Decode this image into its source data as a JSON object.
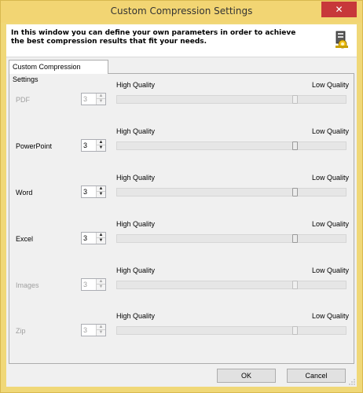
{
  "window": {
    "title": "Custom Compression Settings",
    "close_glyph": "✕"
  },
  "header": {
    "text": "In this window you can define your own parameters in order to achieve\nthe best compression results that fit your needs.",
    "icon": "settings-wizard-icon"
  },
  "tab": {
    "label": "Custom Compression Settings"
  },
  "rows": [
    {
      "label": "PDF",
      "enabled": false,
      "value": "3",
      "high": "High Quality",
      "low": "Low Quality",
      "level": 0.78
    },
    {
      "label": "PowerPoint",
      "enabled": true,
      "value": "3",
      "high": "High Quality",
      "low": "Low Quality",
      "level": 0.78
    },
    {
      "label": "Word",
      "enabled": true,
      "value": "3",
      "high": "High Quality",
      "low": "Low Quality",
      "level": 0.78
    },
    {
      "label": "Excel",
      "enabled": true,
      "value": "3",
      "high": "High Quality",
      "low": "Low Quality",
      "level": 0.78
    },
    {
      "label": "Images",
      "enabled": false,
      "value": "3",
      "high": "High Quality",
      "low": "Low Quality",
      "level": 0.78
    },
    {
      "label": "Zip",
      "enabled": false,
      "value": "3",
      "high": "High Quality",
      "low": "Low Quality",
      "level": 0.78
    }
  ],
  "buttons": {
    "ok": "OK",
    "cancel": "Cancel"
  },
  "spin": {
    "up": "▲",
    "down": "▼"
  }
}
